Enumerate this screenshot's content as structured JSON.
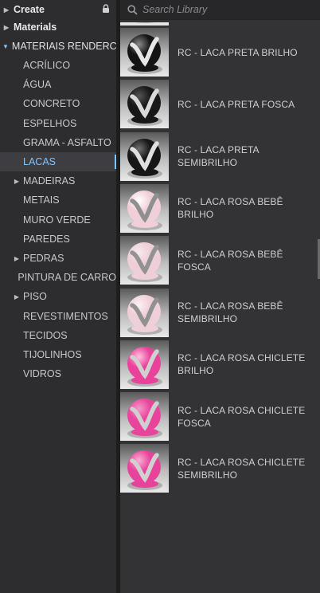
{
  "sidebar": {
    "create": "Create",
    "materials": "Materials",
    "root": "MATERIAIS RENDERC...",
    "items": [
      {
        "label": "ACRÍLICO",
        "expandable": false,
        "selected": false
      },
      {
        "label": "ÁGUA",
        "expandable": false,
        "selected": false
      },
      {
        "label": "CONCRETO",
        "expandable": false,
        "selected": false
      },
      {
        "label": "ESPELHOS",
        "expandable": false,
        "selected": false
      },
      {
        "label": "GRAMA - ASFALTO",
        "expandable": false,
        "selected": false
      },
      {
        "label": "LACAS",
        "expandable": false,
        "selected": true
      },
      {
        "label": "MADEIRAS",
        "expandable": true,
        "selected": false
      },
      {
        "label": "METAIS",
        "expandable": false,
        "selected": false
      },
      {
        "label": "MURO VERDE",
        "expandable": false,
        "selected": false
      },
      {
        "label": "PAREDES",
        "expandable": false,
        "selected": false
      },
      {
        "label": "PEDRAS",
        "expandable": true,
        "selected": false
      },
      {
        "label": "PINTURA DE CARRO",
        "expandable": false,
        "selected": false
      },
      {
        "label": "PISO",
        "expandable": true,
        "selected": false
      },
      {
        "label": "REVESTIMENTOS",
        "expandable": false,
        "selected": false
      },
      {
        "label": "TECIDOS",
        "expandable": false,
        "selected": false
      },
      {
        "label": "TIJOLINHOS",
        "expandable": false,
        "selected": false
      },
      {
        "label": "VIDROS",
        "expandable": false,
        "selected": false
      }
    ]
  },
  "search": {
    "placeholder": "Search Library",
    "value": ""
  },
  "materials": [
    {
      "name": "RC - LACA PRETA BRILHO",
      "color": "#141414",
      "band": "#e6e6e6",
      "hl": "#8a8a8a"
    },
    {
      "name": "RC - LACA PRETA FOSCA",
      "color": "#181818",
      "band": "#d9d9d9",
      "hl": "#555555"
    },
    {
      "name": "RC - LACA PRETA SEMIBRILHO",
      "color": "#161616",
      "band": "#e0e0e0",
      "hl": "#707070"
    },
    {
      "name": "RC - LACA ROSA BEBÊ BRILHO",
      "color": "#f0cfd8",
      "band": "#8f8f8f",
      "hl": "#ffffff"
    },
    {
      "name": "RC - LACA ROSA BEBÊ FOSCA",
      "color": "#efcfd7",
      "band": "#939393",
      "hl": "#f6e8ec"
    },
    {
      "name": "RC - LACA ROSA BEBÊ SEMIBRILHO",
      "color": "#efcfd8",
      "band": "#919191",
      "hl": "#fbf1f4"
    },
    {
      "name": "RC - LACA ROSA CHICLETE BRILHO",
      "color": "#e9429a",
      "band": "#d0d0d0",
      "hl": "#ffc2e0"
    },
    {
      "name": "RC - LACA ROSA CHICLETE FOSCA",
      "color": "#e8449b",
      "band": "#cfcfcf",
      "hl": "#f49ac8"
    },
    {
      "name": "RC - LACA ROSA CHICLETE SEMIBRILHO",
      "color": "#e8439a",
      "band": "#d1d1d1",
      "hl": "#f8b0d4"
    }
  ]
}
